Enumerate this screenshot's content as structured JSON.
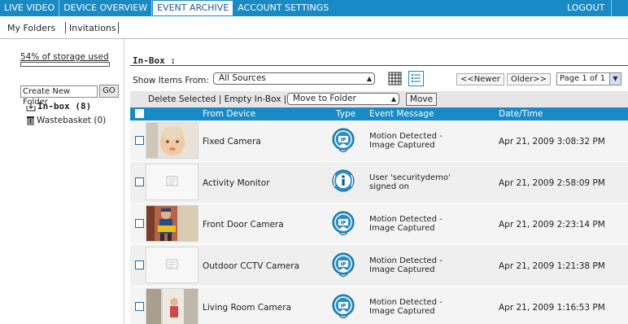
{
  "topnav": {
    "tabs": [
      "LIVE VIDEO",
      "DEVICE OVERVIEW",
      "EVENT ARCHIVE",
      "ACCOUNT SETTINGS"
    ],
    "active_tab": "EVENT ARCHIVE",
    "logout": "LOGOUT"
  },
  "subnav": {
    "my_folders": "My Folders",
    "invitations": "Invitations"
  },
  "sidebar": {
    "storage_text": "54% of storage used",
    "storage_fraction": 0.54,
    "create_folder_placeholder": "Create New Folder",
    "go_label": "GO",
    "folders": [
      {
        "label": "In-box (8)",
        "icon": "inbox-icon"
      },
      {
        "label": "Wastebasket (0)",
        "icon": "trash-icon"
      }
    ]
  },
  "main": {
    "title": "In-Box :",
    "show_items_label": "Show Items From:",
    "source_value": "All Sources",
    "newer_label": "<<Newer",
    "older_label": "Older>>",
    "page_value": "Page 1 of 1",
    "action_text": "Delete Selected | Empty In-Box |",
    "move_to_value": "Move to Folder",
    "move_label": "Move",
    "columns": [
      "From Device",
      "Type",
      "Event Message",
      "Date/Time"
    ],
    "rows": [
      {
        "device": "Fixed Camera",
        "type": "camera-icon",
        "message_line1": "Motion Detected -",
        "message_line2": "Image Captured",
        "date": "Apr 21, 2009 3:08:32 PM",
        "thumb": "baby"
      },
      {
        "device": "Activity Monitor",
        "type": "info-icon",
        "message_line1": "User 'securitydemo'",
        "message_line2": "signed on",
        "date": "Apr 21, 2009 2:58:09 PM",
        "thumb": "note"
      },
      {
        "device": "Front Door Camera",
        "type": "camera-icon",
        "message_line1": "Motion Detected -",
        "message_line2": "Image Captured",
        "date": "Apr 21, 2009 2:23:14 PM",
        "thumb": "person"
      },
      {
        "device": "Outdoor CCTV Camera",
        "type": "camera-icon",
        "message_line1": "Motion Detected -",
        "message_line2": "Image Captured",
        "date": "Apr 21, 2009 1:21:38 PM",
        "thumb": "note"
      },
      {
        "device": "Living Room Camera",
        "type": "camera-icon",
        "message_line1": "Motion Detected -",
        "message_line2": "Image Captured",
        "date": "Apr 21, 2009 1:16:53 PM",
        "thumb": "door"
      }
    ]
  },
  "colors": {
    "nav_blue": "#1a8ac4",
    "header_blue": "#1a8ac4"
  }
}
